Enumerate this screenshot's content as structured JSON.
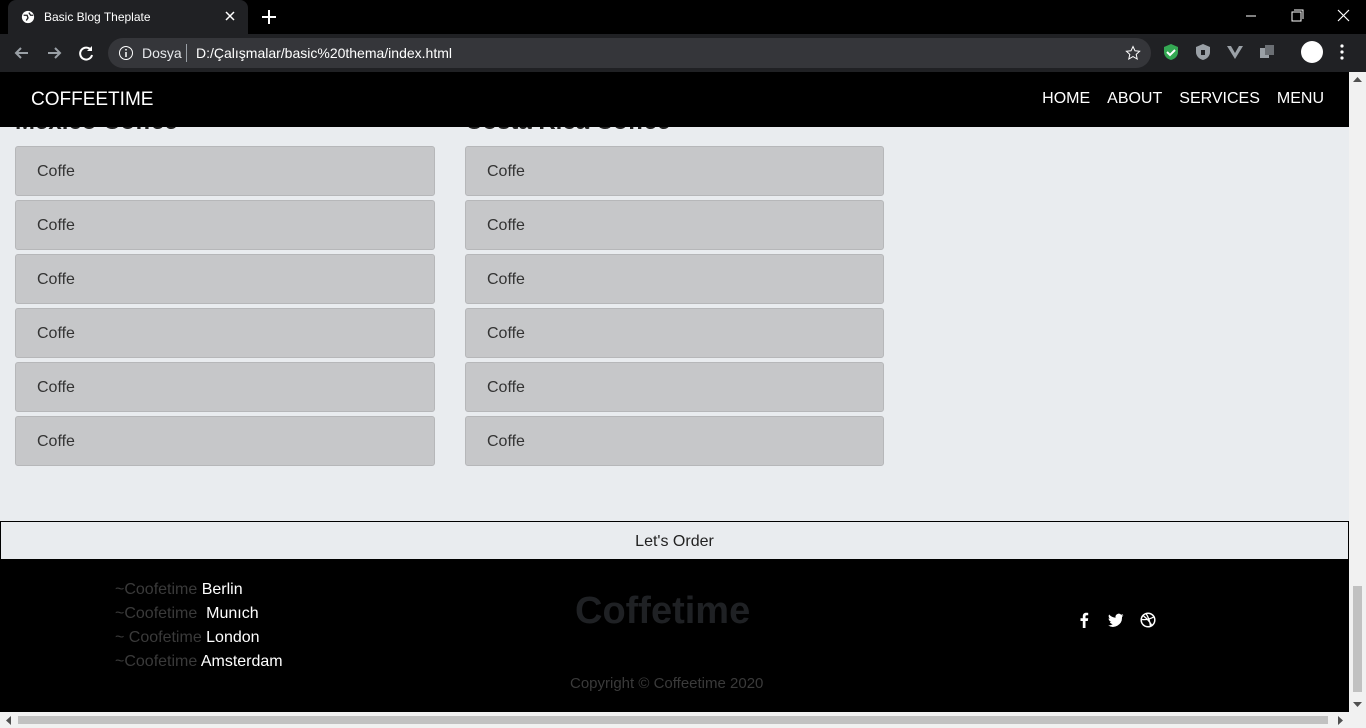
{
  "browser": {
    "tab_title": "Basic Blog Theplate",
    "scheme_label": "Dosya",
    "url": "D:/Çalışmalar/basic%20thema/index.html"
  },
  "navbar": {
    "brand": "COFFEETIME",
    "links": [
      "HOME",
      "ABOUT",
      "SERVICES",
      "MENU"
    ]
  },
  "columns": [
    {
      "heading": "Mexico Coffee",
      "items": [
        "Coffe",
        "Coffe",
        "Coffe",
        "Coffe",
        "Coffe",
        "Coffe"
      ]
    },
    {
      "heading": "Costa Rica Coffee",
      "items": [
        "Coffe",
        "Coffe",
        "Coffe",
        "Coffe",
        "Coffe",
        "Coffe"
      ]
    }
  ],
  "order_button": "Let's Order",
  "footer": {
    "cities": [
      {
        "prefix": "~Coofetime ",
        "city": "Berlin"
      },
      {
        "prefix": "~Coofetime  ",
        "city": "Munıch"
      },
      {
        "prefix": "~ Coofetime ",
        "city": "London"
      },
      {
        "prefix": "~Coofetime ",
        "city": "Amsterdam"
      }
    ],
    "logo": "Coffetime",
    "copyright": "Copyright © Coffeetime 2020",
    "social_icons": [
      "facebook-icon",
      "twitter-icon",
      "dribbble-icon"
    ]
  }
}
